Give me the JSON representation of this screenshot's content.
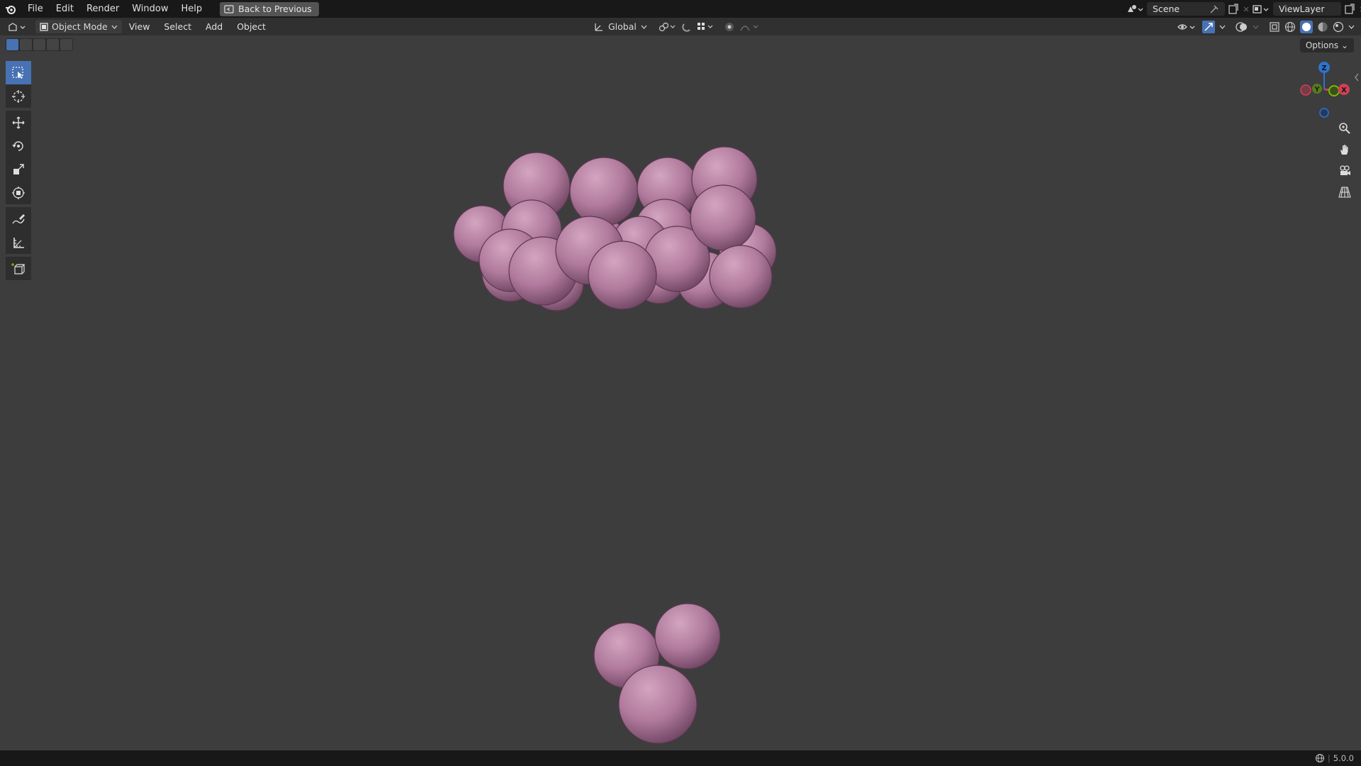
{
  "menu": {
    "items": [
      "File",
      "Edit",
      "Render",
      "Window",
      "Help"
    ],
    "back_button": "Back to Previous"
  },
  "topright": {
    "scene": "Scene",
    "viewlayer": "ViewLayer"
  },
  "header": {
    "mode": "Object Mode",
    "menus": [
      "View",
      "Select",
      "Add",
      "Object"
    ],
    "transform_orientation": "Global"
  },
  "viewport": {
    "options_label": "Options",
    "gizmo": {
      "z": "Z",
      "y": "Y",
      "x": "X"
    },
    "sphere_color": "#b07a9c"
  },
  "status": {
    "version": "5.0.0"
  },
  "colors": {
    "accent": "#4772b3",
    "axis_x": "#d04055",
    "axis_y": "#7ab800",
    "axis_z": "#2f73d0"
  }
}
